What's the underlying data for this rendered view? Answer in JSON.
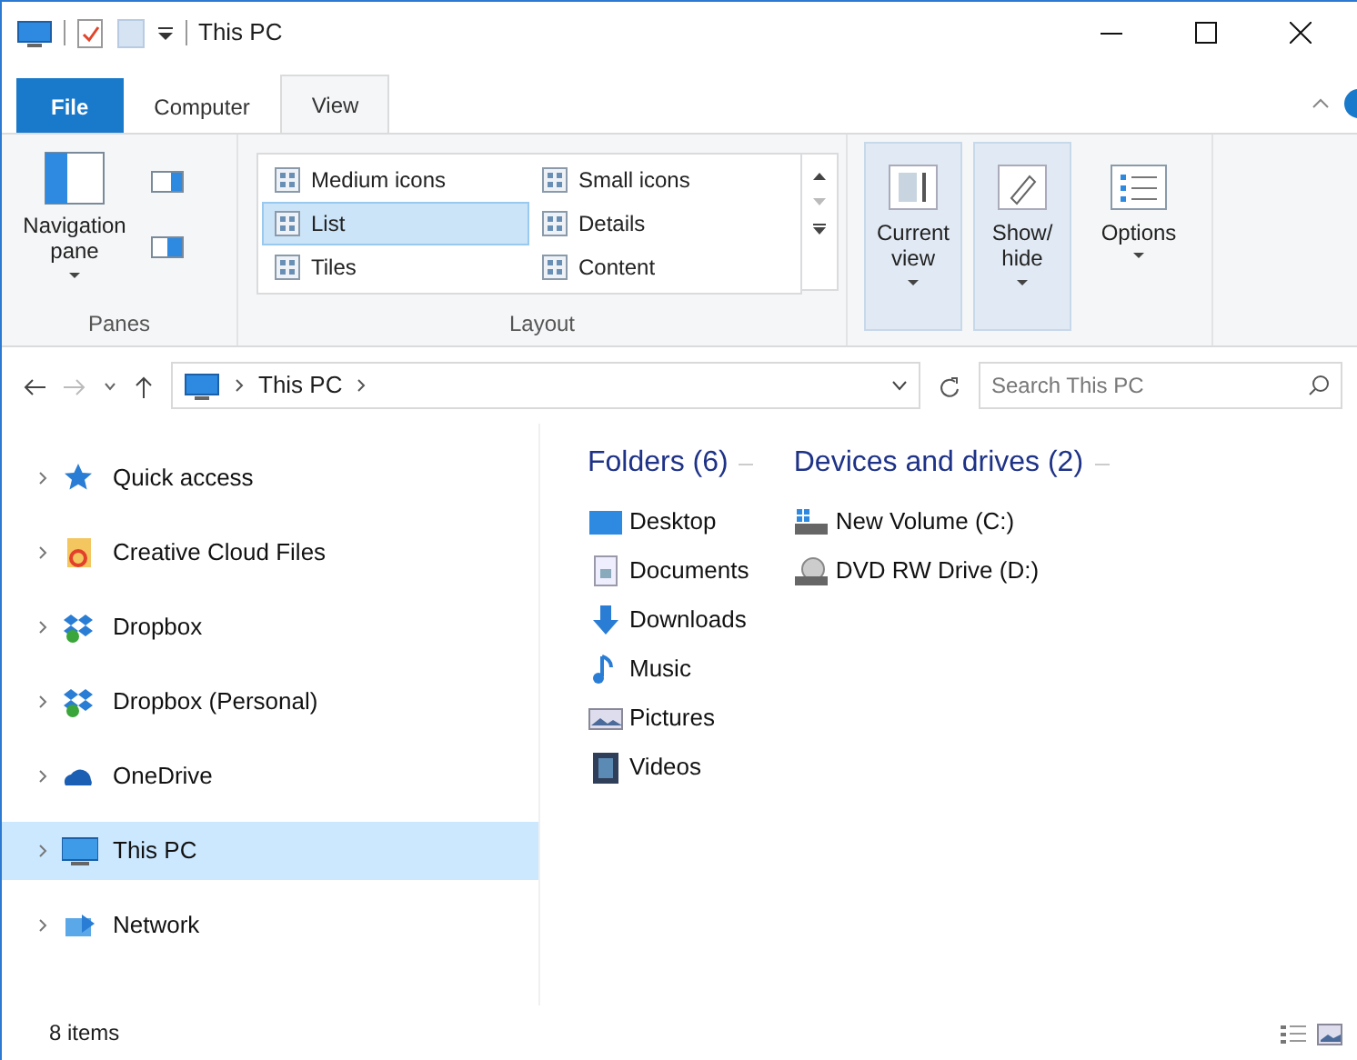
{
  "window": {
    "title": "This PC"
  },
  "ribbon_tabs": [
    {
      "label": "File",
      "kind": "file",
      "selected": false
    },
    {
      "label": "Computer",
      "kind": "tab",
      "selected": false
    },
    {
      "label": "View",
      "kind": "tab",
      "selected": true
    }
  ],
  "panes_group": {
    "label": "Panes",
    "navigation_pane": "Navigation pane"
  },
  "layout_group": {
    "label": "Layout",
    "items": [
      {
        "label": "Medium icons",
        "selected": false
      },
      {
        "label": "Small icons",
        "selected": false
      },
      {
        "label": "List",
        "selected": true
      },
      {
        "label": "Details",
        "selected": false
      },
      {
        "label": "Tiles",
        "selected": false
      },
      {
        "label": "Content",
        "selected": false
      }
    ]
  },
  "view_buttons": [
    {
      "label": "Current view",
      "kind": "current",
      "pressed": true
    },
    {
      "label": "Show/ hide",
      "kind": "showhide",
      "pressed": true
    },
    {
      "label": "Options",
      "kind": "options",
      "pressed": false
    }
  ],
  "address_bar": {
    "path": "This PC",
    "search_placeholder": "Search This PC"
  },
  "sidebar": {
    "items": [
      {
        "label": "Quick access",
        "kind": "star",
        "selected": false
      },
      {
        "label": "Creative Cloud Files",
        "kind": "cloudfolder",
        "selected": false
      },
      {
        "label": "Dropbox",
        "kind": "dropbox",
        "selected": false
      },
      {
        "label": "Dropbox (Personal)",
        "kind": "dropbox",
        "selected": false
      },
      {
        "label": "OneDrive",
        "kind": "onedrive",
        "selected": false
      },
      {
        "label": "This PC",
        "kind": "pc",
        "selected": true
      },
      {
        "label": "Network",
        "kind": "network",
        "selected": false
      }
    ]
  },
  "folders": {
    "heading": "Folders (6)",
    "items": [
      {
        "label": "Desktop",
        "kind": "desktop"
      },
      {
        "label": "Documents",
        "kind": "documents"
      },
      {
        "label": "Downloads",
        "kind": "downloads"
      },
      {
        "label": "Music",
        "kind": "music"
      },
      {
        "label": "Pictures",
        "kind": "pictures"
      },
      {
        "label": "Videos",
        "kind": "videos"
      }
    ]
  },
  "drives": {
    "heading": "Devices and drives (2)",
    "items": [
      {
        "label": "New Volume (C:)",
        "kind": "disk"
      },
      {
        "label": "DVD RW Drive (D:)",
        "kind": "dvd"
      }
    ]
  },
  "status_bar": {
    "text": "8 items"
  }
}
